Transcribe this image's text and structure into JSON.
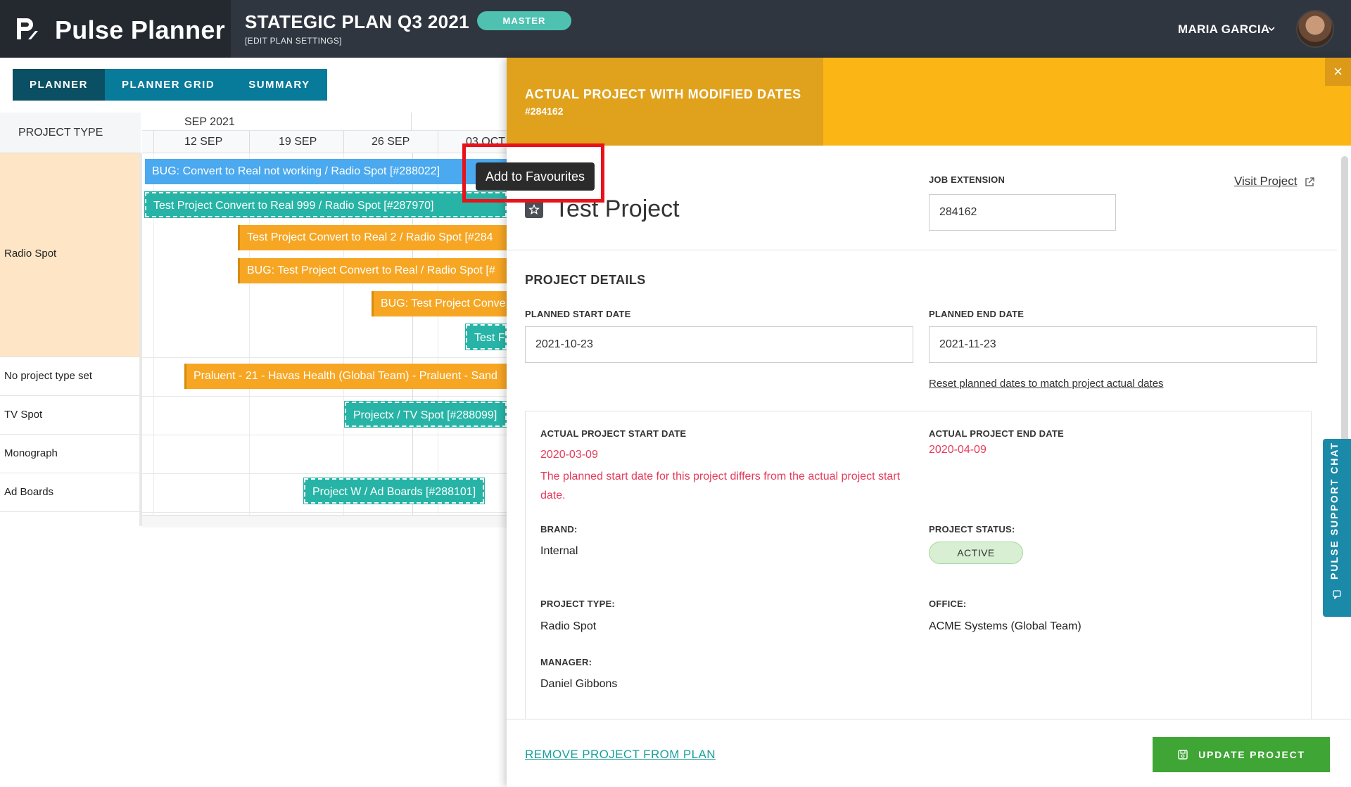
{
  "app": {
    "name": "Pulse Planner",
    "logo_icon": "pulse-logo"
  },
  "plan": {
    "title": "STATEGIC PLAN Q3 2021",
    "settings_link": "[EDIT PLAN SETTINGS]",
    "badge": "MASTER"
  },
  "user": {
    "name": "MARIA GARCIA"
  },
  "tabs": [
    {
      "label": "PLANNER",
      "active": true
    },
    {
      "label": "PLANNER GRID",
      "active": false
    },
    {
      "label": "SUMMARY",
      "active": false
    }
  ],
  "gantt": {
    "type_header": "PROJECT TYPE",
    "month": "SEP 2021",
    "weeks": [
      "12 SEP",
      "19 SEP",
      "26 SEP",
      "03 OCT"
    ],
    "rows": [
      {
        "type": "Radio Spot"
      },
      {
        "type": "No project type set"
      },
      {
        "type": "TV Spot"
      },
      {
        "type": "Monograph"
      },
      {
        "type": "Ad Boards"
      }
    ],
    "bars": [
      {
        "label": "BUG: Convert to Real not working / Radio Spot [#288022]",
        "style": "blue"
      },
      {
        "label": "Test Project Convert to Real 999 / Radio Spot [#287970]",
        "style": "teal"
      },
      {
        "label": "Test Project Convert to Real 2 / Radio Spot [#284",
        "style": "orange"
      },
      {
        "label": "BUG: Test Project Convert to Real / Radio Spot [#",
        "style": "orange"
      },
      {
        "label": "BUG: Test Project Conve",
        "style": "orange"
      },
      {
        "label": "Test Fa",
        "style": "teal"
      },
      {
        "label": "Praluent - 21 - Havas Health (Global Team) - Praluent - Sand",
        "style": "orange"
      },
      {
        "label": "Projectx / TV Spot [#288099]",
        "style": "teal"
      },
      {
        "label": "Project W / Ad Boards [#288101]",
        "style": "teal"
      }
    ]
  },
  "panel": {
    "title": "ACTUAL PROJECT WITH MODIFIED DATES",
    "id": "#284162",
    "project_name": "Test Project",
    "job_extension_label": "JOB EXTENSION",
    "job_extension_value": "284162",
    "visit_link": "Visit Project",
    "section_title": "PROJECT DETAILS",
    "planned_start_label": "PLANNED START DATE",
    "planned_start_value": "2021-10-23",
    "planned_end_label": "PLANNED END DATE",
    "planned_end_value": "2021-11-23",
    "reset_link": "Reset planned dates to match project actual dates",
    "actual_start_label": "ACTUAL PROJECT START DATE",
    "actual_start_value": "2020-03-09",
    "actual_start_warning": "The planned start date for this project differs from the actual project start date.",
    "actual_end_label": "ACTUAL PROJECT END DATE",
    "actual_end_value": "2020-04-09",
    "brand_label": "BRAND:",
    "brand_value": "Internal",
    "status_label": "PROJECT STATUS:",
    "status_value": "ACTIVE",
    "type_label": "PROJECT TYPE:",
    "type_value": "Radio Spot",
    "office_label": "OFFICE:",
    "office_value": "ACME Systems (Global Team)",
    "manager_label": "MANAGER:",
    "manager_value": "Daniel Gibbons",
    "remove_link": "REMOVE PROJECT FROM PLAN",
    "update_button": "UPDATE PROJECT",
    "close_icon": "×"
  },
  "chat": {
    "label": "PULSE SUPPORT CHAT"
  },
  "tooltip": {
    "text": "Add to Favourites"
  },
  "colors": {
    "header": "#2f3640",
    "tab": "#087a9a",
    "panel_header": "#fbb514",
    "accent_green": "#3fa535",
    "warning_red": "#e63b5a"
  }
}
